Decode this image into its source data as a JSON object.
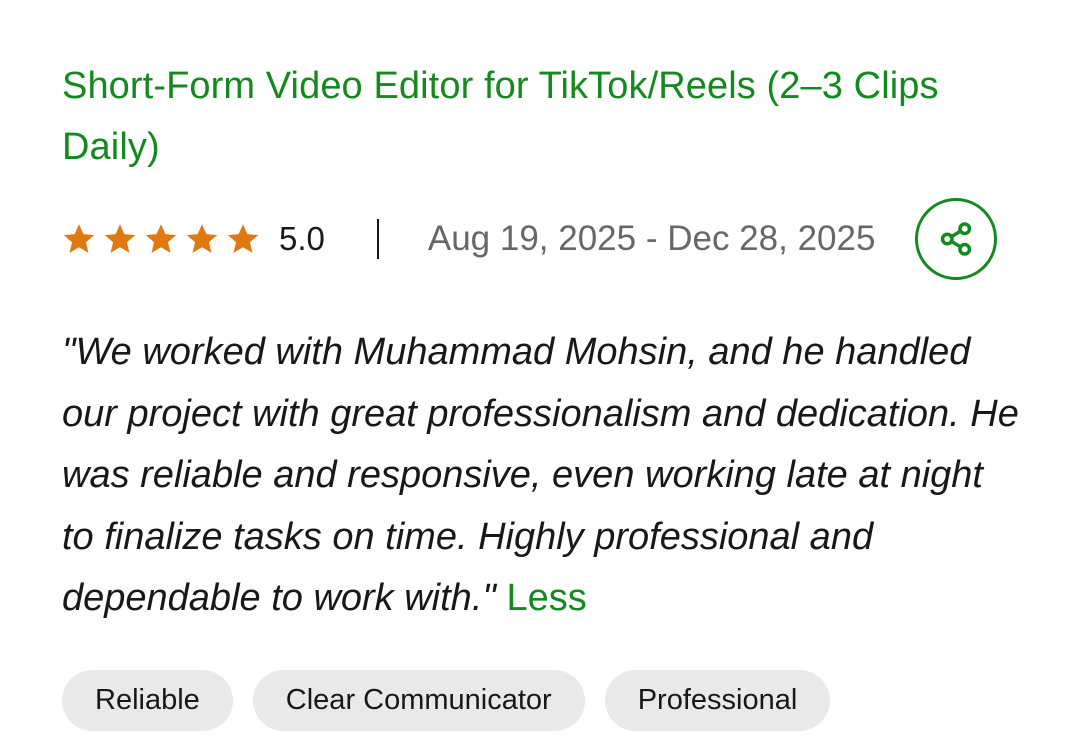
{
  "job": {
    "title": "Short-Form Video Editor for TikTok/Reels (2–3 Clips Daily)"
  },
  "rating": {
    "value": "5.0",
    "stars": 5,
    "star_color": "#e07a10",
    "star_icon": "star-icon"
  },
  "date_range": "Aug 19, 2025 - Dec 28, 2025",
  "share": {
    "icon": "share-icon",
    "color": "#14891d"
  },
  "review": {
    "text": "\"We worked with Muhammad Mohsin, and he handled our project with great professionalism and dedication. He was reliable and responsive, even working late at night to finalize tasks on time. Highly professional and dependable to work with.\"",
    "toggle_label": "Less"
  },
  "tags": [
    {
      "label": "Reliable"
    },
    {
      "label": "Clear Communicator"
    },
    {
      "label": "Professional"
    }
  ],
  "colors": {
    "accent": "#14891d",
    "text": "#181818",
    "muted": "#676767",
    "tag_bg": "#e9e9e9"
  }
}
